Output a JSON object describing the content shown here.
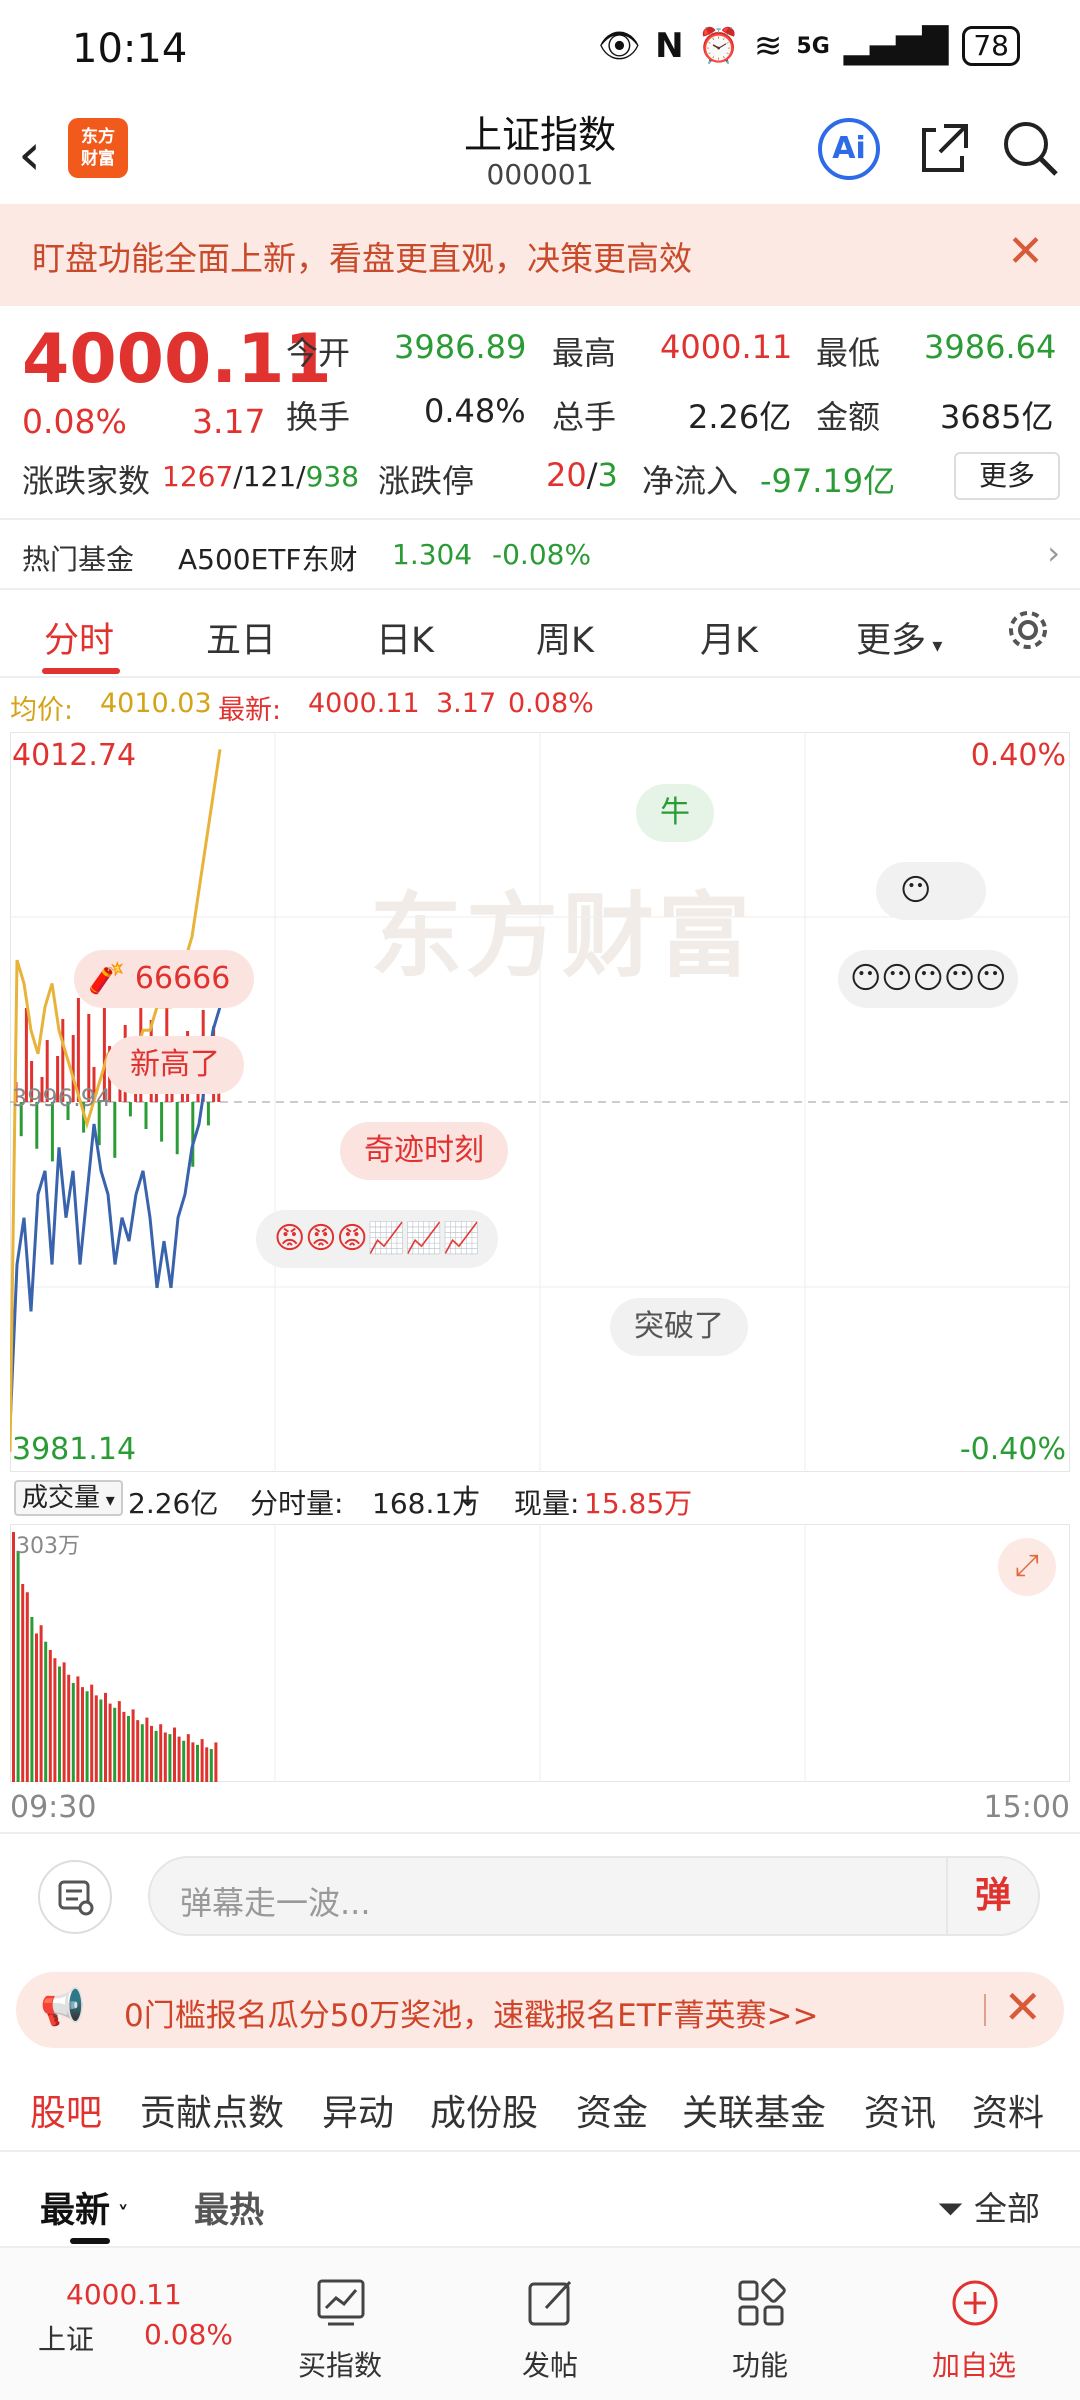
{
  "status_bar": {
    "time": "10:14",
    "network": "5G",
    "battery": "78"
  },
  "header": {
    "title": "上证指数",
    "code": "000001",
    "logo_text": "东方财富",
    "ai_label": "Ai"
  },
  "banner": {
    "text": "盯盘功能全面上新，看盘更直观，决策更高效"
  },
  "quote": {
    "price": "4000.11",
    "change_pct": "0.08%",
    "change": "3.17",
    "open_label": "今开",
    "open": "3986.89",
    "high_label": "最高",
    "high": "4000.11",
    "low_label": "最低",
    "low": "3986.64",
    "turnover_label": "换手",
    "turnover": "0.48%",
    "volume_label": "总手",
    "volume": "2.26亿",
    "amount_label": "金额",
    "amount": "3685亿",
    "updown_label": "涨跌家数",
    "up": "1267",
    "flat": "121",
    "down": "938",
    "limit_label": "涨跌停",
    "limit_up": "20",
    "limit_down": "3",
    "netflow_label": "净流入",
    "netflow": "-97.19亿",
    "more_label": "更多"
  },
  "fund": {
    "label": "热门基金",
    "name": "A500ETF东财",
    "price": "1.304",
    "change": "-0.08%"
  },
  "tabs": [
    "分时",
    "五日",
    "日K",
    "周K",
    "月K",
    "更多"
  ],
  "info": {
    "avg_label": "均价:",
    "avg": "4010.03",
    "latest_label": "最新:",
    "latest": "4000.11",
    "chg": "3.17",
    "pct": "0.08%"
  },
  "chart_data": {
    "type": "line",
    "y_top": "4012.74",
    "y_bottom": "3981.14",
    "pct_top": "0.40%",
    "pct_bottom": "-0.40%",
    "prev_close_label": "3996.94",
    "watermark": "东方财富",
    "x_start": "09:30",
    "x_end": "15:00",
    "series": [
      {
        "values": [
          3983,
          3990,
          3992,
          3988,
          3993,
          3994,
          3990,
          3995,
          3992,
          3994,
          3990,
          3993,
          3996,
          3994,
          3993,
          3990,
          3992,
          3991,
          3993,
          3994,
          3992,
          3989,
          3991,
          3989,
          3992,
          3993,
          3995,
          3996,
          3998,
          4000,
          4001
        ]
      },
      {
        "values": [
          3982,
          4003,
          4002,
          4000,
          3999,
          4001,
          4002,
          4000,
          3999,
          3998,
          3997,
          3996,
          3997,
          3998,
          3999,
          3999,
          3998,
          3999,
          3999,
          4000,
          4000,
          4001,
          4001,
          4001,
          4002,
          4003,
          4004,
          4006,
          4008,
          4010,
          4012
        ]
      }
    ],
    "volume": {
      "max_label": "303万",
      "values": [
        303,
        280,
        240,
        230,
        200,
        180,
        190,
        170,
        160,
        150,
        140,
        145,
        130,
        120,
        128,
        115,
        110,
        118,
        105,
        100,
        108,
        95,
        90,
        98,
        85,
        80,
        88,
        75,
        70,
        78,
        68,
        62,
        70,
        60,
        58,
        66,
        55,
        50,
        58,
        48,
        45,
        52,
        42,
        40,
        48
      ]
    }
  },
  "danmu": [
    {
      "text": "牛",
      "style": "green"
    },
    {
      "text": "66666",
      "style": "red"
    },
    {
      "text": "新高了",
      "style": "red"
    },
    {
      "text": "奇迹时刻",
      "style": "red"
    },
    {
      "text": "突破了",
      "style": "gray"
    }
  ],
  "volume_row": {
    "label": "成交量",
    "total": "2.26亿",
    "period_label": "分时量:",
    "period": "168.1万",
    "now_label": "现量:",
    "now": "15.85万"
  },
  "comment": {
    "placeholder": "弹幕走一波...",
    "button": "弹"
  },
  "promo": {
    "text": "0门槛报名瓜分50万奖池，速戳报名ETF菁英赛>>"
  },
  "subtabs": [
    "股吧",
    "贡献点数",
    "异动",
    "成份股",
    "资金",
    "关联基金",
    "资讯",
    "资料"
  ],
  "sort": {
    "latest": "最新",
    "hot": "最热",
    "filter": "全部"
  },
  "bottom_nav": {
    "mini_price": "4000.11",
    "mini_name": "上证",
    "mini_pct": "0.08%",
    "items": [
      "买指数",
      "发帖",
      "功能",
      "加自选"
    ]
  }
}
